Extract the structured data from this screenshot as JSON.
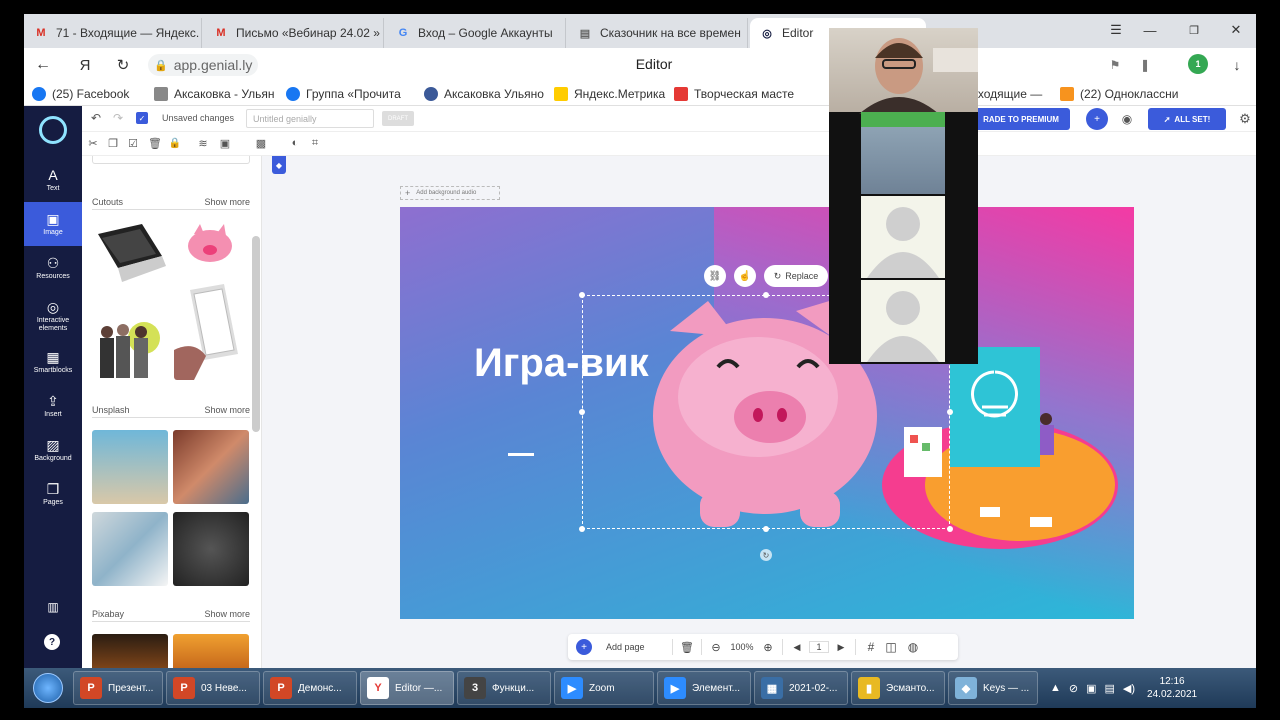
{
  "browser": {
    "tabs": [
      {
        "label": "71 - Входящие — Яндекс.",
        "icon": "gmail-icon"
      },
      {
        "label": "Письмо «Вебинар 24.02 »",
        "icon": "gmail-icon"
      },
      {
        "label": "Вход – Google Аккаунты",
        "icon": "google-icon"
      },
      {
        "label": "Сказочник на все времен",
        "icon": "page-icon"
      },
      {
        "label": "Editor",
        "icon": "genially-icon"
      }
    ],
    "address_prefix": "Я",
    "url": "app.genial.ly",
    "page_title": "Editor",
    "bookmarks": [
      {
        "label": "(25) Facebook",
        "color": "#1877f2"
      },
      {
        "label": "Аксаковка - Ульян",
        "color": "#888888"
      },
      {
        "label": "Группа «Прочита",
        "color": "#1877f2"
      },
      {
        "label": "Аксаковка Ульяно",
        "color": "#3b5998"
      },
      {
        "label": "Яндекс.Метрика",
        "color": "#ffcc00"
      },
      {
        "label": "Творческая масте",
        "color": "#e53935"
      },
      {
        "label": "Входящие — ",
        "color": "#e53935"
      },
      {
        "label": "(22) Одноклассни",
        "color": "#f7931e"
      }
    ],
    "extension_badge": "1",
    "download_badge": "1"
  },
  "editor": {
    "unsaved_label": "Unsaved changes",
    "title_placeholder": "Untitled genially",
    "draft_badge": "DRAFT",
    "upgrade_label": "RADE TO PREMIUM",
    "all_set_label": "ALL SET!",
    "add_background_audio": "Add background audio",
    "nav": [
      {
        "label": "Text",
        "icon": "text-icon"
      },
      {
        "label": "Image",
        "icon": "image-icon"
      },
      {
        "label": "Resources",
        "icon": "resources-icon"
      },
      {
        "label": "Interactive elements",
        "icon": "interactive-icon"
      },
      {
        "label": "Smartblocks",
        "icon": "smartblocks-icon"
      },
      {
        "label": "Insert",
        "icon": "insert-icon"
      },
      {
        "label": "Background",
        "icon": "background-icon"
      },
      {
        "label": "Pages",
        "icon": "pages-icon"
      }
    ],
    "panel": {
      "sections": [
        {
          "title": "Cutouts",
          "show_more": "Show more"
        },
        {
          "title": "Unsplash",
          "show_more": "Show more"
        },
        {
          "title": "Pixabay",
          "show_more": "Show more"
        }
      ]
    },
    "slide": {
      "title": "Игра-вик",
      "dash": "—",
      "replace_label": "Replace"
    },
    "bottom": {
      "add_page": "Add page",
      "zoom": "100%",
      "page_number": "1"
    }
  },
  "taskbar": {
    "items": [
      {
        "label": "Презент...",
        "color": "#d24726",
        "glyph": "P"
      },
      {
        "label": "03 Неве...",
        "color": "#d24726",
        "glyph": "P"
      },
      {
        "label": "Демонс...",
        "color": "#d24726",
        "glyph": "P"
      },
      {
        "label": "Editor —...",
        "color": "#ffffff",
        "glyph": "Y"
      },
      {
        "label": "Функци...",
        "color": "#444444",
        "glyph": "3"
      },
      {
        "label": "Zoom",
        "color": "#2d8cff",
        "glyph": "Z"
      },
      {
        "label": "Элемент...",
        "color": "#2d8cff",
        "glyph": "Z"
      },
      {
        "label": "2021-02-...",
        "color": "#3a6ea5",
        "glyph": "▦"
      },
      {
        "label": "Эсманто...",
        "color": "#e8b923",
        "glyph": "▮"
      },
      {
        "label": "Keys — ...",
        "color": "#7fb2d9",
        "glyph": "◆"
      }
    ],
    "time": "12:16",
    "date": "24.02.2021"
  }
}
